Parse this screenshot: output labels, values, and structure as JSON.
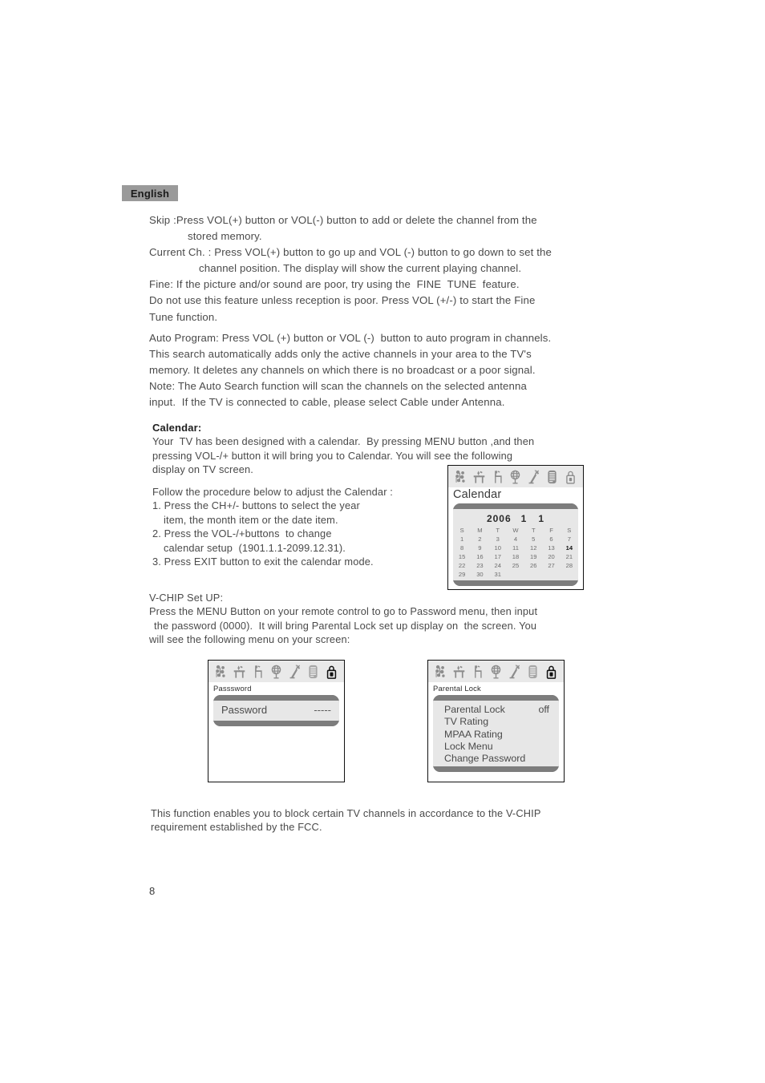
{
  "language_tab": {
    "label": "English"
  },
  "page_number": "8",
  "sections": {
    "tuning": [
      "Skip :Press VOL(+) button or VOL(-) button to add or delete the channel from the",
      "stored memory.",
      "Current Ch. : Press VOL(+) button to go up and VOL (-) button to go down to set the",
      "channel position. The display will show the current playing channel.",
      "Fine: If the picture and/or sound are poor, try using the  FINE  TUNE  feature.",
      "Do not use this feature unless reception is poor. Press VOL (+/-) to start the Fine",
      "Tune function."
    ],
    "auto_program": [
      "Auto Program: Press VOL (+) button or VOL (-)  button to auto program in channels.",
      "This search automatically adds only the active channels in your area to the TV's",
      "memory. It deletes any channels on which there is no broadcast or a poor signal.",
      "Note: The Auto Search function will scan the channels on the selected antenna",
      "input.  If the TV is connected to cable, please select Cable under Antenna."
    ],
    "calendar_intro": {
      "heading": "Calendar:",
      "lines": [
        "Your  TV has been designed with a calendar.  By pressing MENU button ,and then",
        "pressing VOL-/+ button it will bring you to Calendar. You will see the following",
        "display on TV screen."
      ]
    },
    "calendar_steps": [
      "Follow the procedure below to adjust the Calendar :",
      "1. Press the CH+/- buttons to select the year",
      "item, the month item or the date item.",
      "2. Press the VOL-/+buttons  to change",
      "calendar setup  (1901.1.1-2099.12.31).",
      "3. Press EXIT button to exit the calendar mode."
    ],
    "vchip_setup": [
      "V-CHIP Set UP:",
      "Press the MENU Button on your remote control to go to Password menu, then input",
      "the password (0000).  It will bring Parental Lock set up display on  the screen. You",
      "will see the following menu on your screen:"
    ],
    "vchip_note": [
      "This function enables you to block certain TV channels in accordance to the V-CHIP",
      "requirement established by the FCC."
    ]
  },
  "osd_icons": [
    "picture-icon",
    "sound-icon",
    "setup-icon",
    "language-globe-icon",
    "antenna-icon",
    "channel-list-icon",
    "lock-icon"
  ],
  "osd_calendar": {
    "title": "Calendar",
    "year": "2006",
    "month": "1",
    "day": "1",
    "weekday_headers": [
      "S",
      "M",
      "T",
      "W",
      "T",
      "F",
      "S"
    ],
    "weeks": [
      [
        "1",
        "2",
        "3",
        "4",
        "5",
        "6",
        "7"
      ],
      [
        "8",
        "9",
        "10",
        "11",
        "12",
        "13",
        "14"
      ],
      [
        "15",
        "16",
        "17",
        "18",
        "19",
        "20",
        "21"
      ],
      [
        "22",
        "23",
        "24",
        "25",
        "26",
        "27",
        "28"
      ],
      [
        "29",
        "30",
        "31",
        "",
        "",
        "",
        ""
      ]
    ],
    "selected_day": "14"
  },
  "osd_password": {
    "title": "Passsword",
    "row_label": "Password",
    "row_value": "-----"
  },
  "osd_parental": {
    "title": "Parental  Lock",
    "items": [
      {
        "label": "Parental Lock",
        "value": "off"
      },
      {
        "label": "TV Rating",
        "value": ""
      },
      {
        "label": "MPAA Rating",
        "value": ""
      },
      {
        "label": "Lock Menu",
        "value": ""
      },
      {
        "label": "Change Password",
        "value": ""
      }
    ]
  },
  "colors": {
    "tab_bg": "#9a9a9a",
    "osd_iconbar_bg": "#e9e9e9",
    "osd_panel_frame": "#7d7d7d",
    "osd_panel_inner": "#e7e7e7",
    "text": "#4a4a4a"
  }
}
